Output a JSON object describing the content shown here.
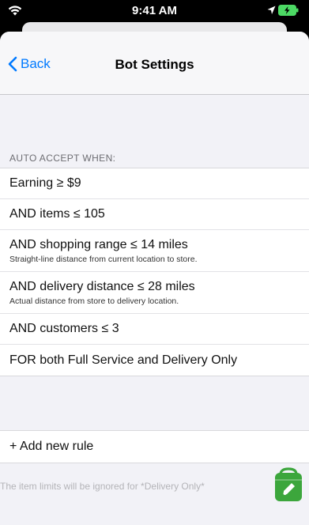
{
  "status_bar": {
    "time": "9:41 AM"
  },
  "nav": {
    "back_label": "Back",
    "title": "Bot Settings"
  },
  "section": {
    "header": "AUTO ACCEPT WHEN:"
  },
  "rules": [
    {
      "title": "Earning ≥ $9",
      "subtitle": ""
    },
    {
      "title": "AND items ≤ 105",
      "subtitle": ""
    },
    {
      "title": "AND shopping range ≤ 14 miles",
      "subtitle": "Straight-line distance from current location to store."
    },
    {
      "title": "AND delivery distance ≤ 28 miles",
      "subtitle": "Actual distance from store to delivery location."
    },
    {
      "title": "AND customers ≤ 3",
      "subtitle": ""
    },
    {
      "title": "FOR both Full Service and Delivery Only",
      "subtitle": ""
    }
  ],
  "add_rule_label": "+ Add new rule",
  "footer_note": "The item limits will be ignored for *Delivery Only*",
  "colors": {
    "accent": "#007aff",
    "fab_green": "#3ca63c",
    "background": "#f2f2f7"
  },
  "icons": {
    "status_left": "wifi-icon",
    "status_right": [
      "location-arrow-icon",
      "battery-charging-icon"
    ],
    "back": "chevron-left-icon",
    "fab": "shopping-bag-icon"
  }
}
